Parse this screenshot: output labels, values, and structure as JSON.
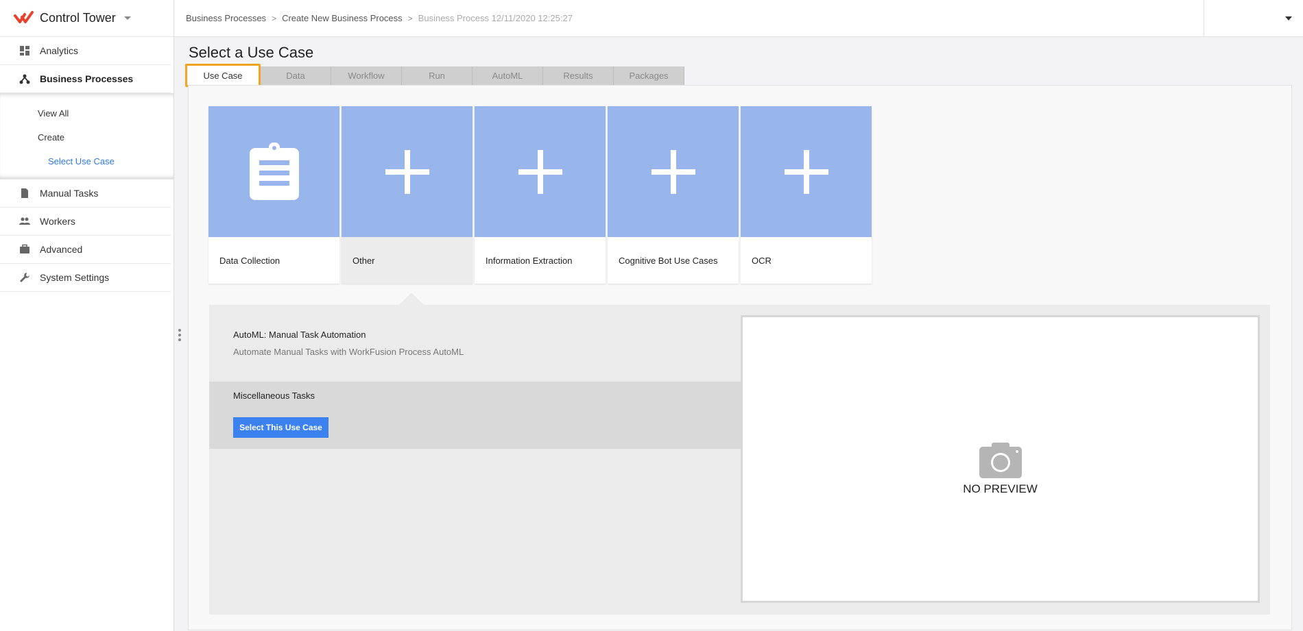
{
  "app": {
    "name": "Control Tower",
    "accent_color": "#e8422f"
  },
  "sidebar": {
    "items": [
      {
        "label": "Analytics",
        "icon": "dashboard-icon"
      },
      {
        "label": "Business Processes",
        "icon": "hierarchy-icon",
        "active": true
      },
      {
        "label": "Manual Tasks",
        "icon": "document-icon"
      },
      {
        "label": "Workers",
        "icon": "people-icon"
      },
      {
        "label": "Advanced",
        "icon": "briefcase-icon"
      },
      {
        "label": "System Settings",
        "icon": "wrench-icon"
      }
    ],
    "subnav": {
      "view_all": "View All",
      "create": "Create",
      "select_use_case": "Select Use Case"
    }
  },
  "breadcrumb": {
    "items": [
      "Business Processes",
      "Create New Business Process",
      "Business Process 12/11/2020 12:25:27"
    ]
  },
  "page": {
    "title": "Select a Use Case"
  },
  "tabs": [
    {
      "label": "Use Case",
      "active": true
    },
    {
      "label": "Data"
    },
    {
      "label": "Workflow"
    },
    {
      "label": "Run"
    },
    {
      "label": "AutoML"
    },
    {
      "label": "Results"
    },
    {
      "label": "Packages"
    }
  ],
  "cards": [
    {
      "label": "Data Collection",
      "icon": "clipboard-icon"
    },
    {
      "label": "Other",
      "icon": "plus-icon",
      "selected": true
    },
    {
      "label": "Information Extraction",
      "icon": "plus-icon"
    },
    {
      "label": "Cognitive Bot Use Cases",
      "icon": "plus-icon"
    },
    {
      "label": "OCR",
      "icon": "plus-icon"
    }
  ],
  "details": {
    "use_case_title": "AutoML: Manual Task Automation",
    "use_case_description": "Automate Manual Tasks with WorkFusion Process AutoML",
    "misc_title": "Miscellaneous Tasks",
    "select_button": "Select This Use Case",
    "preview_text": "NO PREVIEW"
  },
  "colors": {
    "card_tile": "#98b6ec",
    "primary_button": "#3b82f0",
    "active_tab_outline": "#f0a623",
    "link": "#2f7ae5"
  }
}
